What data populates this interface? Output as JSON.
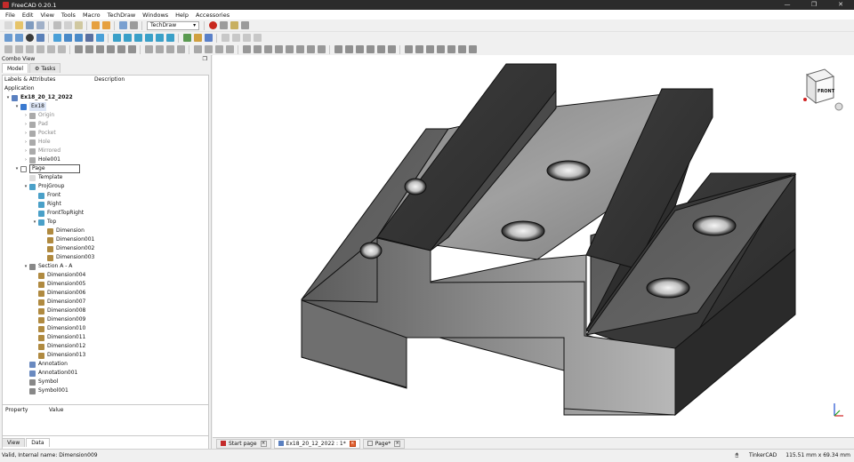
{
  "window": {
    "title": "FreeCAD 0.20.1",
    "controls": [
      "—",
      "❐",
      "✕"
    ]
  },
  "menu": [
    "File",
    "Edit",
    "View",
    "Tools",
    "Macro",
    "TechDraw",
    "Windows",
    "Help",
    "Accessories"
  ],
  "toolbar": {
    "workbench": "TechDraw"
  },
  "combo_view": {
    "title": "Combo View",
    "tabs": [
      "Model",
      "Tasks"
    ],
    "tree_headers": [
      "Labels & Attributes",
      "Description"
    ],
    "root": "Application",
    "items": [
      {
        "label": "Ex18_20_12_2022",
        "level": 0,
        "bold": true,
        "icon": "document-icon"
      },
      {
        "label": "Ex18",
        "level": 1,
        "selected": true,
        "icon": "body-icon"
      },
      {
        "label": "Origin",
        "level": 2,
        "dim": true,
        "icon": "origin-icon"
      },
      {
        "label": "Pad",
        "level": 2,
        "dim": true,
        "icon": "pad-icon"
      },
      {
        "label": "Pocket",
        "level": 2,
        "dim": true,
        "icon": "pocket-icon"
      },
      {
        "label": "Hole",
        "level": 2,
        "dim": true,
        "icon": "hole-icon"
      },
      {
        "label": "Mirrored",
        "level": 2,
        "dim": true,
        "icon": "mirrored-icon"
      },
      {
        "label": "Hole001",
        "level": 2,
        "icon": "hole-icon"
      },
      {
        "label": "Page",
        "level": 1,
        "icon": "page-icon"
      },
      {
        "label": "Template",
        "level": 2,
        "icon": "template-icon"
      },
      {
        "label": "ProjGroup",
        "level": 2,
        "icon": "projgroup-icon"
      },
      {
        "label": "Front",
        "level": 3,
        "icon": "view-icon"
      },
      {
        "label": "Right",
        "level": 3,
        "icon": "view-icon"
      },
      {
        "label": "FrontTopRight",
        "level": 3,
        "icon": "view-icon"
      },
      {
        "label": "Top",
        "level": 3,
        "icon": "view-icon"
      },
      {
        "label": "Dimension",
        "level": 4,
        "icon": "vertical-dimension-icon"
      },
      {
        "label": "Dimension001",
        "level": 4,
        "icon": "vertical-dimension-icon"
      },
      {
        "label": "Dimension002",
        "level": 4,
        "icon": "horizontal-dimension-icon"
      },
      {
        "label": "Dimension003",
        "level": 4,
        "icon": "horizontal-dimension-icon"
      },
      {
        "label": "Section A - A",
        "level": 2,
        "icon": "section-icon"
      },
      {
        "label": "Dimension004",
        "level": 3,
        "icon": "horizontal-dimension-icon"
      },
      {
        "label": "Dimension005",
        "level": 3,
        "icon": "vertical-dimension-icon"
      },
      {
        "label": "Dimension006",
        "level": 3,
        "icon": "horizontal-dimension-icon"
      },
      {
        "label": "Dimension007",
        "level": 3,
        "icon": "horizontal-dimension-icon"
      },
      {
        "label": "Dimension008",
        "level": 3,
        "icon": "horizontal-dimension-icon"
      },
      {
        "label": "Dimension009",
        "level": 3,
        "icon": "vertical-dimension-icon"
      },
      {
        "label": "Dimension010",
        "level": 3,
        "icon": "horizontal-dimension-icon"
      },
      {
        "label": "Dimension011",
        "level": 3,
        "icon": "horizontal-dimension-icon"
      },
      {
        "label": "Dimension012",
        "level": 3,
        "icon": "horizontal-dimension-icon"
      },
      {
        "label": "Dimension013",
        "level": 3,
        "icon": "horizontal-dimension-icon"
      },
      {
        "label": "Annotation",
        "level": 2,
        "icon": "annotation-icon"
      },
      {
        "label": "Annotation001",
        "level": 2,
        "icon": "annotation-icon"
      },
      {
        "label": "Symbol",
        "level": 2,
        "icon": "symbol-icon"
      },
      {
        "label": "Symbol001",
        "level": 2,
        "icon": "symbol-icon"
      }
    ],
    "property_headers": [
      "Property",
      "Value"
    ],
    "bottom_tabs": [
      "View",
      "Data"
    ]
  },
  "nav_cube": {
    "face": "FRONT"
  },
  "document_tabs": [
    {
      "label": "Start page"
    },
    {
      "label": "Ex18_20_12_2022 : 1*",
      "active": true
    },
    {
      "label": "Page*"
    }
  ],
  "status": {
    "message": "Valid, Internal name: Dimension009",
    "navigation": "TinkerCAD",
    "dimensions": "115.51 mm x 69.34 mm"
  },
  "colors": {
    "titlebar": "#2b2b2b",
    "selection": "#dde6f6",
    "model": "#6a6a6a"
  }
}
